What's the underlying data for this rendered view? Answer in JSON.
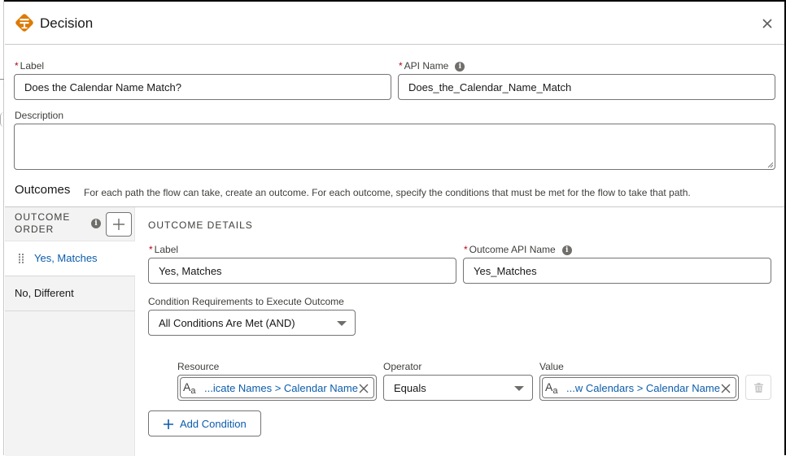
{
  "header": {
    "title": "Decision",
    "icon": "decision-signpost-icon",
    "close_icon": "close-icon"
  },
  "colors": {
    "brand_orange": "#dd7a01",
    "link_blue": "#0b5cab",
    "required_red": "#ba0517"
  },
  "form": {
    "label": {
      "label": "Label",
      "required": "*",
      "value": "Does the Calendar Name Match?"
    },
    "api_name": {
      "label": "API Name",
      "required": "*",
      "value": "Does_the_Calendar_Name_Match"
    },
    "description": {
      "label": "Description",
      "value": ""
    }
  },
  "outcomes": {
    "title": "Outcomes",
    "help": "For each path the flow can take, create an outcome. For each outcome, specify the conditions that must be met for the flow to take that path.",
    "order_header": "OUTCOME ORDER",
    "order_header_line1": "OUTCOME",
    "order_header_line2": "ORDER",
    "items": [
      {
        "label": "Yes, Matches",
        "active": true
      },
      {
        "label": "No, Different",
        "active": false
      }
    ]
  },
  "details": {
    "section_title": "OUTCOME DETAILS",
    "label": {
      "label": "Label",
      "required": "*",
      "value": "Yes, Matches"
    },
    "api_name": {
      "label": "Outcome API Name",
      "required": "*",
      "value": "Yes_Matches"
    },
    "condition_requirements": {
      "label": "Condition Requirements to Execute Outcome",
      "value": "All Conditions Are Met (AND)"
    },
    "condition": {
      "resource_label": "Resource",
      "resource_value": "...icate Names > Calendar Name",
      "operator_label": "Operator",
      "operator_value": "Equals",
      "value_label": "Value",
      "value_value": "...w Calendars > Calendar Name"
    },
    "add_condition": "Add Condition"
  }
}
